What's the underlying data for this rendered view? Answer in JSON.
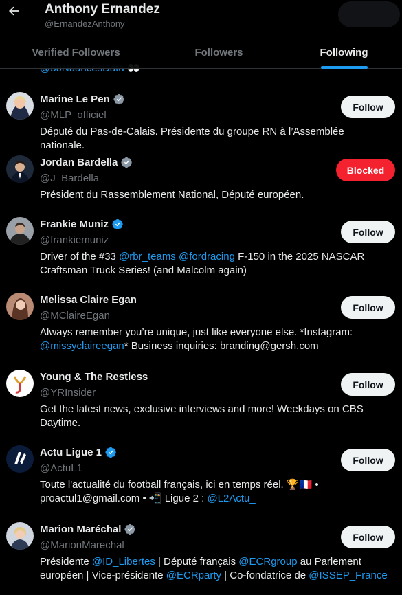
{
  "header": {
    "title": "Anthony Ernandez",
    "handle": "@ErnandezAnthony"
  },
  "tabs": [
    {
      "label": "Verified Followers",
      "active": false
    },
    {
      "label": "Followers",
      "active": false
    },
    {
      "label": "Following",
      "active": true
    }
  ],
  "partial_row_text": "@50NuancesData 👀",
  "colors": {
    "accent": "#1d9bf0",
    "blocked": "#f4212e",
    "gold_badge": "#8b98a5"
  },
  "users": [
    {
      "name": "Marine Le Pen",
      "badge": "gray",
      "handle": "@MLP_officiel",
      "button": "Follow",
      "bio": [
        {
          "t": "Député du Pas-de-Calais. Présidente du groupe RN à l’Assemblée nationale.",
          "link": false
        }
      ]
    },
    {
      "name": "Jordan Bardella",
      "badge": "gray",
      "handle": "@J_Bardella",
      "button": "Blocked",
      "bio": [
        {
          "t": "Président du Rassemblement National, Député européen.",
          "link": false
        }
      ]
    },
    {
      "name": "Frankie Muniz",
      "badge": "blue",
      "handle": "@frankiemuniz",
      "button": "Follow",
      "bio": [
        {
          "t": "Driver of the #33 ",
          "link": false
        },
        {
          "t": "@rbr_teams",
          "link": true
        },
        {
          "t": " ",
          "link": false
        },
        {
          "t": "@fordracing",
          "link": true
        },
        {
          "t": " F-150 in the 2025 NASCAR Craftsman Truck Series! (and Malcolm again)",
          "link": false
        }
      ]
    },
    {
      "name": "Melissa Claire Egan",
      "badge": "",
      "handle": "@MClaireEgan",
      "button": "Follow",
      "bio": [
        {
          "t": "Always remember you’re unique, just like everyone else. *Instagram: ",
          "link": false
        },
        {
          "t": "@missyclaireegan",
          "link": true
        },
        {
          "t": "* Business inquiries: branding@gersh.com",
          "link": false
        }
      ]
    },
    {
      "name": "Young & The Restless",
      "badge": "",
      "handle": "@YRInsider",
      "button": "Follow",
      "bio": [
        {
          "t": "Get the latest news, exclusive interviews and more! Weekdays on CBS Daytime.",
          "link": false
        }
      ]
    },
    {
      "name": "Actu Ligue 1",
      "badge": "blue",
      "handle": "@ActuL1_",
      "button": "Follow",
      "bio": [
        {
          "t": "Toute l'actualité du football français, ici en temps réel. 🏆🇫🇷 • proactul1@gmail.com • 📲 Ligue 2 : ",
          "link": false
        },
        {
          "t": "@L2Actu_",
          "link": true
        }
      ]
    },
    {
      "name": "Marion Maréchal",
      "badge": "gray",
      "handle": "@MarionMarechal",
      "button": "Follow",
      "bio": [
        {
          "t": "Présidente ",
          "link": false
        },
        {
          "t": "@ID_Libertes",
          "link": true
        },
        {
          "t": " | Député français ",
          "link": false
        },
        {
          "t": "@ECRgroup",
          "link": true
        },
        {
          "t": " au Parlement européen | Vice-présidente ",
          "link": false
        },
        {
          "t": "@ECRparty",
          "link": true
        },
        {
          "t": " | Co-fondatrice de ",
          "link": false
        },
        {
          "t": "@ISSEP_France",
          "link": true
        }
      ]
    }
  ]
}
